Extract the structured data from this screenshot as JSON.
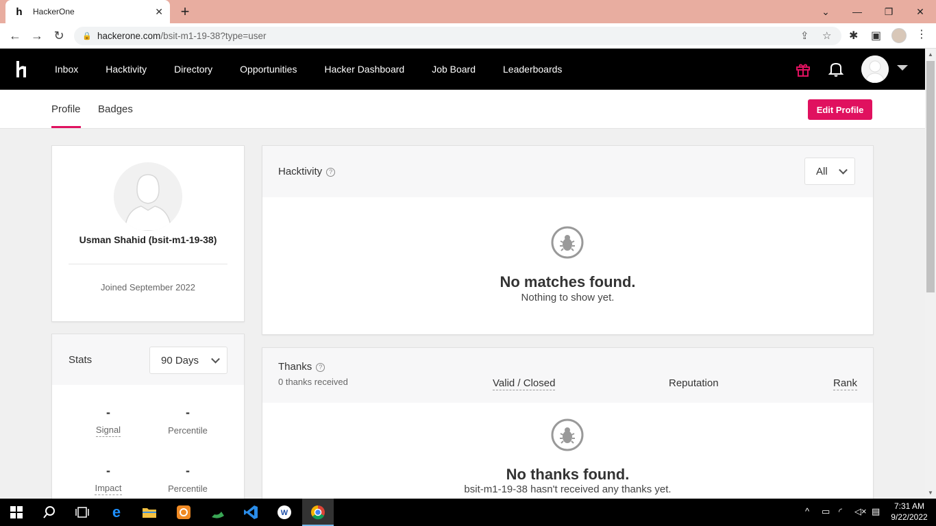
{
  "browser": {
    "tab_title": "HackerOne",
    "url_domain": "hackerone.com",
    "url_path": "/bsit-m1-19-38?type=user"
  },
  "header": {
    "logo": "h1",
    "nav": [
      "Inbox",
      "Hacktivity",
      "Directory",
      "Opportunities",
      "Hacker Dashboard",
      "Job Board",
      "Leaderboards"
    ]
  },
  "subnav": {
    "tabs": [
      "Profile",
      "Badges"
    ],
    "active_tab": "Profile",
    "edit_button": "Edit Profile"
  },
  "profile": {
    "name": "Usman Shahid (bsit-m1-19-38)",
    "joined": "Joined September 2022"
  },
  "stats": {
    "title": "Stats",
    "period": "90 Days",
    "items": [
      {
        "value": "-",
        "label": "Signal"
      },
      {
        "value": "-",
        "label": "Percentile"
      },
      {
        "value": "-",
        "label": "Impact"
      },
      {
        "value": "-",
        "label": "Percentile"
      }
    ]
  },
  "hacktivity": {
    "title": "Hacktivity",
    "filter": "All",
    "empty_title": "No matches found.",
    "empty_sub": "Nothing to show yet."
  },
  "thanks": {
    "title": "Thanks",
    "count_text": "0 thanks received",
    "columns": [
      "Valid / Closed",
      "Reputation",
      "Rank"
    ],
    "empty_title": "No thanks found.",
    "empty_sub": "bsit-m1-19-38 hasn't received any thanks yet."
  },
  "taskbar": {
    "time": "7:31 AM",
    "date": "9/22/2022"
  },
  "colors": {
    "brand": "#e0115f",
    "header_bg": "#000000",
    "tabbar_bg": "#e8ada0"
  }
}
